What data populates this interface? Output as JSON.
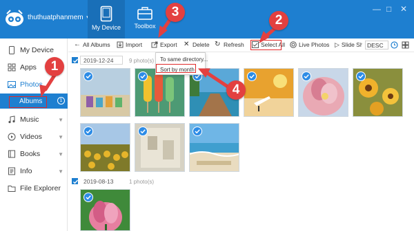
{
  "header": {
    "username": "thuthuatphanmem",
    "nav": [
      {
        "label": "My Device",
        "icon": "phone-icon",
        "active": true
      },
      {
        "label": "Toolbox",
        "icon": "toolbox-icon",
        "active": false
      }
    ],
    "window_controls": [
      "—",
      "□",
      "✕"
    ]
  },
  "sidebar": {
    "items": [
      {
        "label": "My Device",
        "icon": "phone-icon"
      },
      {
        "label": "Apps",
        "icon": "apps-icon"
      },
      {
        "label": "Photos",
        "icon": "photo-icon"
      },
      {
        "label": "Albums",
        "badge": "1"
      },
      {
        "label": "Music",
        "icon": "music-icon"
      },
      {
        "label": "Videos",
        "icon": "video-icon"
      },
      {
        "label": "Books",
        "icon": "book-icon"
      },
      {
        "label": "Info",
        "icon": "info-icon"
      },
      {
        "label": "File Explorer",
        "icon": "folder-icon"
      }
    ]
  },
  "toolbar": {
    "all_albums": "All Albums",
    "import": "Import",
    "export": "Export",
    "delete": "Delete",
    "refresh": "Refresh",
    "select_all": "Select All",
    "live_photos": "Live Photos",
    "slide_show": "Slide Show",
    "sort": "DESC"
  },
  "export_menu": {
    "items": [
      "To same directory...",
      "Sort by month"
    ]
  },
  "groups": [
    {
      "date": "2019-12-24",
      "count": "9 photo(s)"
    },
    {
      "date": "2019-08-13",
      "count": "1 photo(s)"
    }
  ],
  "callouts": [
    "1",
    "2",
    "3",
    "4"
  ],
  "colors": {
    "accent": "#1e7fd0",
    "callout": "#e34040",
    "highlight_border": "#e02828"
  }
}
